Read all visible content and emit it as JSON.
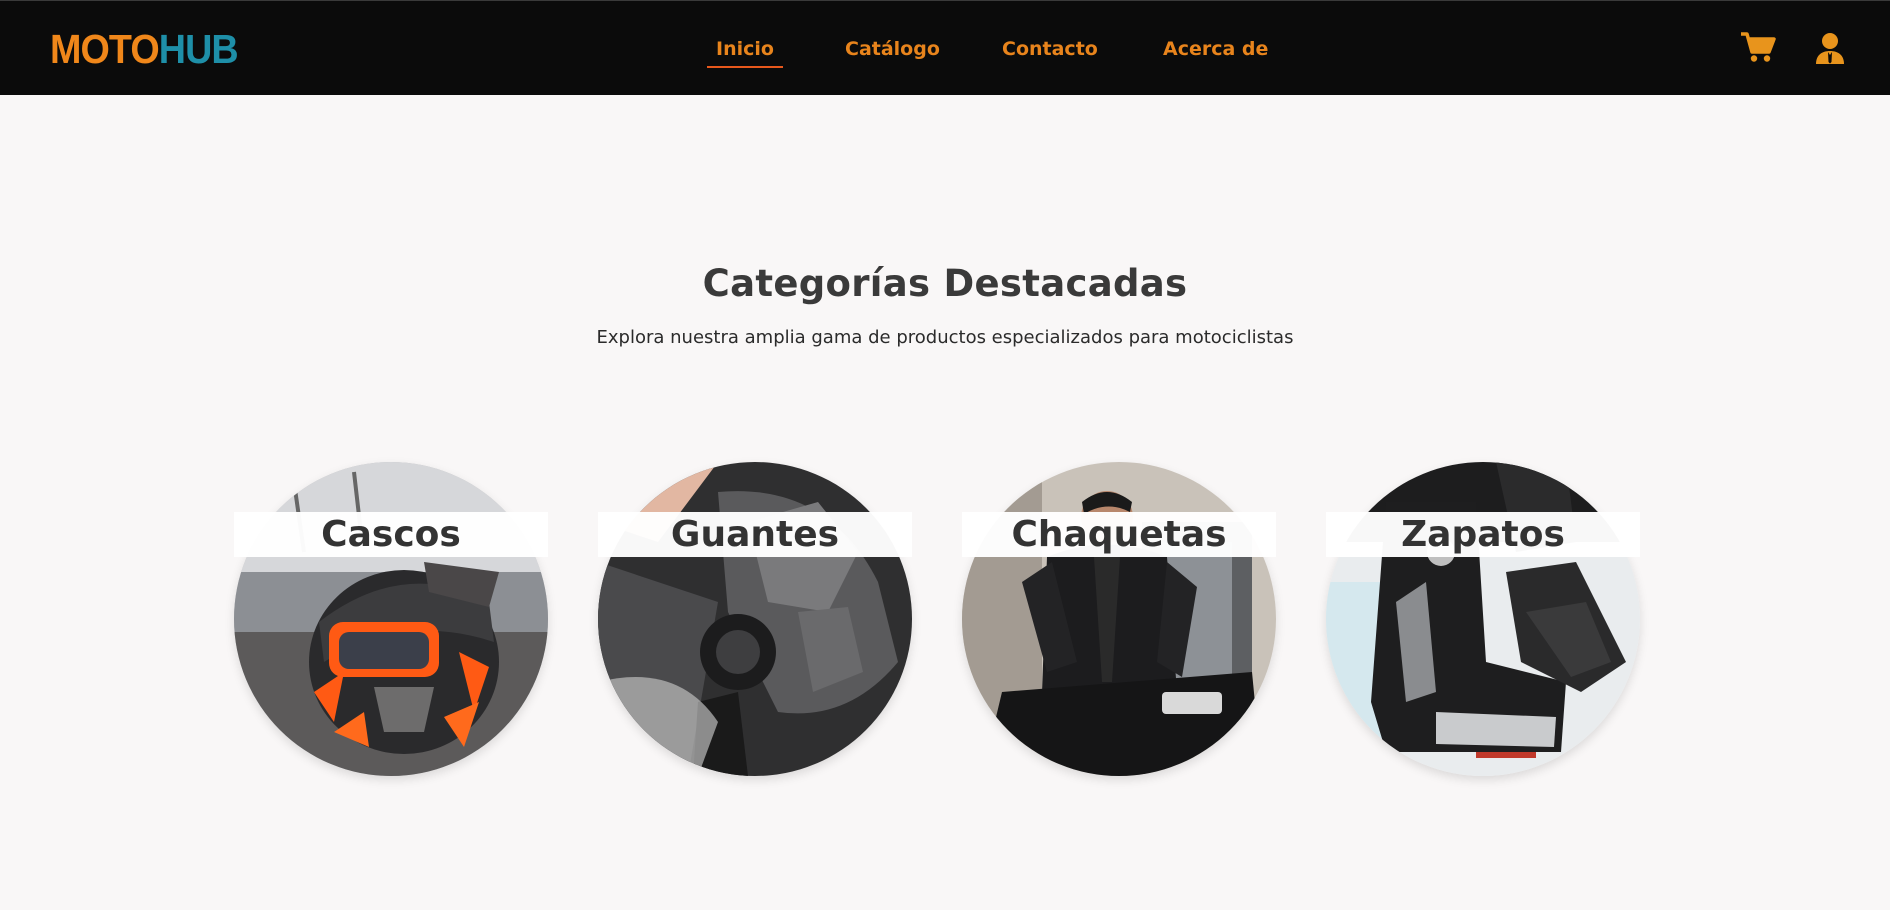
{
  "brand": {
    "logo_part1": "MOTO",
    "logo_part2": "HUB",
    "color_part1": "#f0871a",
    "color_part2": "#1e8fa8"
  },
  "nav": {
    "links": [
      {
        "label": "Inicio",
        "active": true
      },
      {
        "label": "Catálogo",
        "active": false
      },
      {
        "label": "Contacto",
        "active": false
      },
      {
        "label": "Acerca de",
        "active": false
      }
    ],
    "icons": [
      "cart-icon",
      "user-icon"
    ],
    "accent_color": "#e8841c"
  },
  "section": {
    "title": "Categorías Destacadas",
    "subtitle": "Explora nuestra amplia gama de productos especializados para motociclistas"
  },
  "categories": [
    {
      "label": "Cascos",
      "image": "helmet-photo"
    },
    {
      "label": "Guantes",
      "image": "gloves-photo"
    },
    {
      "label": "Chaquetas",
      "image": "jacket-photo"
    },
    {
      "label": "Zapatos",
      "image": "boots-photo"
    }
  ]
}
